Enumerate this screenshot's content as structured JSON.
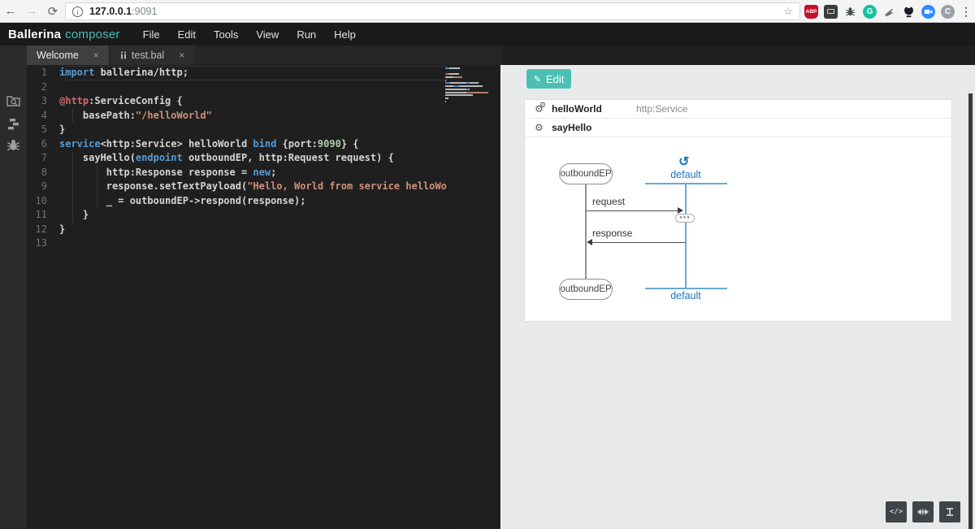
{
  "browser": {
    "back": "←",
    "forward": "→",
    "reload": "⟳",
    "url_host": "127.0.0.1",
    "url_port": ":9091",
    "bookmark_star": "☆",
    "extensions": [
      "adblock-plus",
      "screenshot-extension",
      "bug-extension",
      "grammarly-extension",
      "swoosh-extension",
      "octocat-extension",
      "zoom-extension",
      "c-circle-extension"
    ],
    "menu_dots": "⋮"
  },
  "header": {
    "brand_primary": "Ballerina",
    "brand_secondary": "composer",
    "menus": [
      "File",
      "Edit",
      "Tools",
      "View",
      "Run",
      "Help"
    ]
  },
  "tabs": [
    {
      "label": "Welcome",
      "close_icon": "×",
      "active": true,
      "file_icon": false
    },
    {
      "label": "test.bal",
      "close_icon": "×",
      "active": false,
      "file_icon": true
    }
  ],
  "editor": {
    "colors": {
      "p": "#d4d4d4",
      "kw": "#569cd6",
      "str": "#ce9178",
      "num": "#b5cea8",
      "ann": "#d16969"
    },
    "lines": [
      {
        "n": 1,
        "segs": [
          [
            "kw",
            "import"
          ],
          [
            "p",
            " ballerina/http;"
          ]
        ]
      },
      {
        "n": 2,
        "segs": []
      },
      {
        "n": 3,
        "segs": [
          [
            "ann",
            "@http"
          ],
          [
            "p",
            ":ServiceConfig {"
          ]
        ]
      },
      {
        "n": 4,
        "segs": [
          [
            "p",
            "    basePath:"
          ],
          [
            "str",
            "\"/helloWorld\""
          ]
        ]
      },
      {
        "n": 5,
        "segs": [
          [
            "p",
            "}"
          ]
        ]
      },
      {
        "n": 6,
        "segs": [
          [
            "kw",
            "service"
          ],
          [
            "p",
            "<http:Service> helloWorld "
          ],
          [
            "kw",
            "bind"
          ],
          [
            "p",
            " {port:"
          ],
          [
            "num",
            "9090"
          ],
          [
            "p",
            "} {"
          ]
        ]
      },
      {
        "n": 7,
        "segs": [
          [
            "p",
            "    sayHello("
          ],
          [
            "kw",
            "endpoint"
          ],
          [
            "p",
            " outboundEP, http:Request request) {"
          ]
        ]
      },
      {
        "n": 8,
        "segs": [
          [
            "p",
            "        http:Response response = "
          ],
          [
            "kw",
            "new"
          ],
          [
            "p",
            ";"
          ]
        ]
      },
      {
        "n": 9,
        "segs": [
          [
            "p",
            "        response.setTextPayload("
          ],
          [
            "str",
            "\"Hello, World from service helloWo"
          ]
        ]
      },
      {
        "n": 10,
        "segs": [
          [
            "p",
            "        _ = outboundEP->respond(response);"
          ]
        ]
      },
      {
        "n": 11,
        "segs": [
          [
            "p",
            "    }"
          ]
        ]
      },
      {
        "n": 12,
        "segs": [
          [
            "p",
            "}"
          ]
        ]
      },
      {
        "n": 13,
        "segs": []
      }
    ]
  },
  "diagram": {
    "edit_button": "Edit",
    "service": {
      "name": "helloWorld",
      "type": "http:Service"
    },
    "resource": {
      "name": "sayHello"
    },
    "endpoint_top": "outboundEP",
    "endpoint_bottom": "outboundEP",
    "worker_top": "default",
    "worker_bottom": "default",
    "worker_icon": "↺",
    "request_label": "request",
    "response_label": "response",
    "action_dots": "●●●",
    "accent_teal": "#4bbfb3",
    "accent_blue": "#1878be"
  }
}
